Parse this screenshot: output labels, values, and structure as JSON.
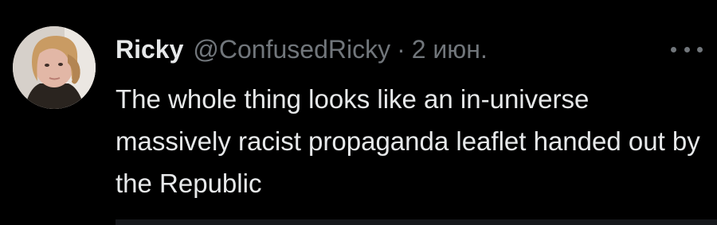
{
  "tweet": {
    "display_name": "Ricky",
    "handle": "@ConfusedRicky",
    "separator": "·",
    "timestamp": "2 июн.",
    "text": "The whole thing looks like an in-universe massively racist propaganda leaflet handed out by the Republic",
    "more_icon": "more-horizontal-icon"
  },
  "colors": {
    "background": "#000000",
    "primary_text": "#e7e9ea",
    "secondary_text": "#71767b"
  }
}
